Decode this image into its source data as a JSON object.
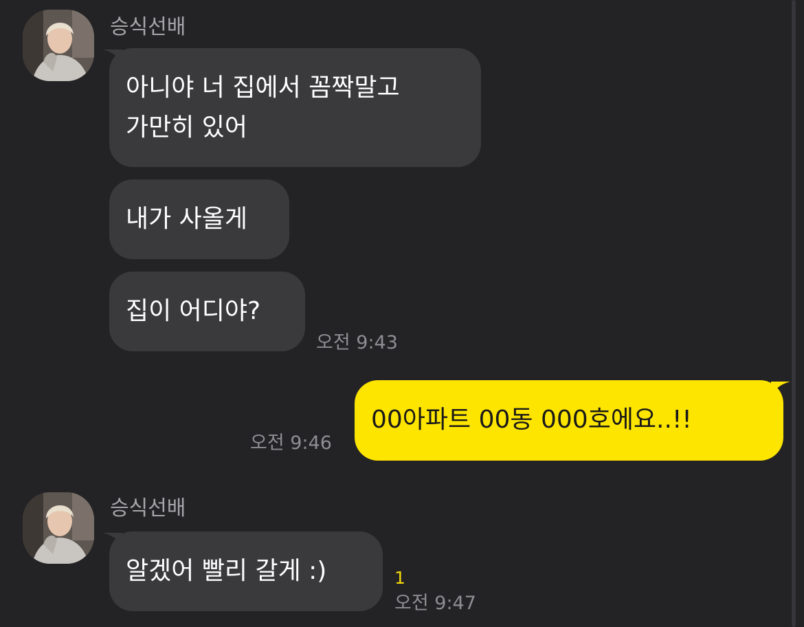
{
  "conversation": {
    "group1": {
      "sender": "승식선배",
      "messages": [
        {
          "line1": "아니야 너 집에서 꼼짝말고",
          "line2": "가만히 있어"
        },
        {
          "line1": "내가 사올게"
        },
        {
          "line1": "집이 어디야?"
        }
      ],
      "time": "오전 9:43"
    },
    "my_message": {
      "text": "00아파트 00동 000호에요..!!",
      "time": "오전 9:46"
    },
    "group2": {
      "sender": "승식선배",
      "message": "알겠어 빨리 갈게 :)",
      "unread_count": "1",
      "time": "오전 9:47"
    }
  },
  "icons": {
    "avatar": "profile-photo"
  },
  "colors": {
    "background": "#232325",
    "incoming_bubble": "#3a3a3d",
    "outgoing_bubble": "#fee500",
    "sender_name": "#a7a7ab",
    "timestamp": "#8e8e93",
    "unread_badge": "#f5d90a"
  }
}
